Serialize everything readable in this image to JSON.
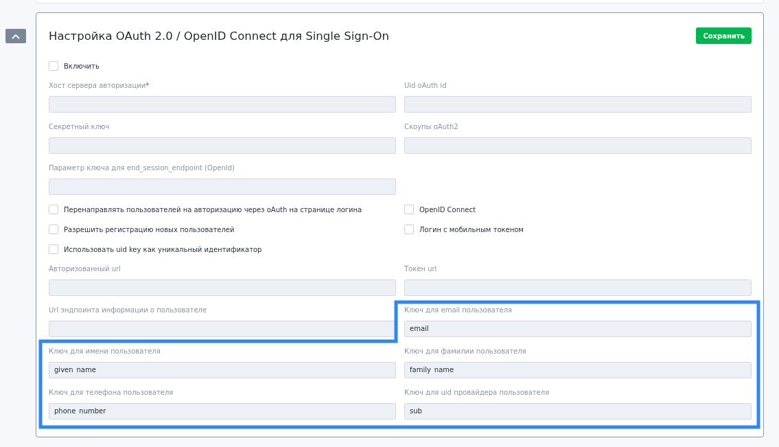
{
  "panel": {
    "title": "Настройка OAuth 2.0 / OpenID Connect для Single Sign-On",
    "save_button": "Сохранить",
    "enable": {
      "label": "Включить",
      "checked": false
    },
    "rows": [
      {
        "cells": [
          {
            "kind": "field",
            "label": "Хост сервера авторизации",
            "required_mark": "*"
          },
          {
            "kind": "field",
            "label": "Uid oAuth id"
          }
        ]
      },
      {
        "cells": [
          {
            "kind": "field",
            "label": "Секретный ключ"
          },
          {
            "kind": "field",
            "label": "Скоупы oAuth2"
          }
        ]
      },
      {
        "cells": [
          {
            "kind": "field",
            "label": "Параметр ключа для end_session_endpoint (OpenId)"
          }
        ]
      },
      {
        "cells": [
          {
            "kind": "checkbox",
            "label": "Перенаправлять пользователей на авторизацию через oAuth на странице логина",
            "checked": false
          },
          {
            "kind": "checkbox",
            "label": "OpenID Connect",
            "checked": false
          }
        ]
      },
      {
        "cells": [
          {
            "kind": "checkbox",
            "label": "Разрешить регистрацию новых пользователей",
            "checked": false
          },
          {
            "kind": "checkbox",
            "label": "Логин с мобильным токеном",
            "checked": false
          }
        ]
      },
      {
        "cells": [
          {
            "kind": "checkbox",
            "label": "Использовать uid key как уникальный идентификатор",
            "checked": false
          }
        ]
      },
      {
        "cells": [
          {
            "kind": "field",
            "label": "Авторизованный url"
          },
          {
            "kind": "field",
            "label": "Токен url"
          }
        ]
      },
      {
        "cells": [
          {
            "kind": "field",
            "label": "Url эндпоинта информации о пользователе"
          },
          {
            "kind": "field",
            "label": "Ключ для email пользователя",
            "value": "email"
          }
        ]
      },
      {
        "cells": [
          {
            "kind": "field",
            "label": "Ключ для имени пользователя",
            "value": "given_name"
          },
          {
            "kind": "field",
            "label": "Ключ для фамилии пользователя",
            "value": "family_name"
          }
        ]
      },
      {
        "cells": [
          {
            "kind": "field",
            "label": "Ключ для телефона пользователя",
            "value": "phone_number"
          },
          {
            "kind": "field",
            "label": "Ключ для uid провайдера пользователя",
            "value": "sub"
          }
        ]
      }
    ]
  }
}
